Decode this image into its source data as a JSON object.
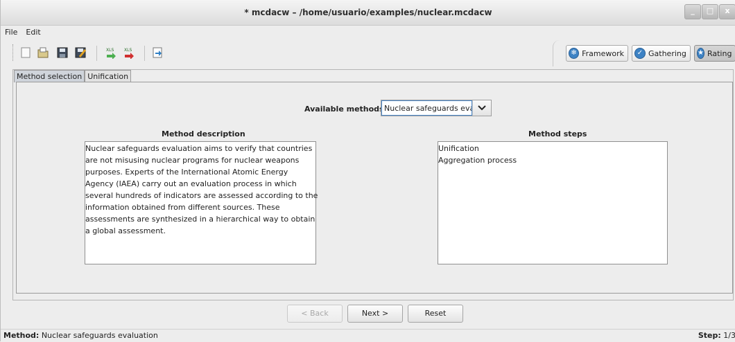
{
  "window": {
    "title": "* mcdacw – /home/usuario/examples/nuclear.mcdacw",
    "controls": [
      "_",
      "□",
      "x"
    ]
  },
  "menu": {
    "items": [
      "File",
      "Edit"
    ]
  },
  "toolbar": {
    "icons": [
      "new-icon",
      "open-icon",
      "save-icon",
      "save-as-icon",
      "import-xls-icon",
      "export-xls-icon",
      "export-icon"
    ]
  },
  "modes": {
    "items": [
      {
        "label": "Framework",
        "icon": "framework-icon",
        "active": false
      },
      {
        "label": "Gathering",
        "icon": "gathering-icon",
        "active": false
      },
      {
        "label": "Rating",
        "icon": "rating-icon",
        "active": true
      }
    ]
  },
  "tabs": [
    {
      "label": "Method selection",
      "selected": true
    },
    {
      "label": "Unification",
      "selected": false
    }
  ],
  "method_selection": {
    "available_label": "Available methods",
    "selected_method": "Nuclear safeguards eva",
    "description_title": "Method description",
    "description_lines": [
      "Nuclear safeguards evaluation aims to verify that countries",
      "are not misusing nuclear programs for nuclear weapons",
      "purposes. Experts of the International Atomic Energy",
      "Agency (IAEA) carry out an evaluation process in which",
      "several hundreds of indicators are assessed according to the",
      "information obtained from different sources. These",
      "assessments are synthesized in a hierarchical way to obtain",
      "a global assessment."
    ],
    "steps_title": "Method steps",
    "steps": [
      "Unification",
      "Aggregation process"
    ]
  },
  "buttons": {
    "back": "< Back",
    "next": "Next >",
    "reset": "Reset"
  },
  "status": {
    "method_key": "Method:",
    "method_value": "Nuclear safeguards evaluation",
    "step_key": "Step:",
    "step_value": "1/3"
  },
  "colors": {
    "accent": "#4a87c9",
    "mode_icon": "#3d82c4"
  }
}
